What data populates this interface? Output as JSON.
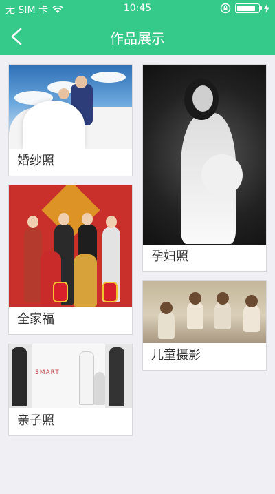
{
  "status_bar": {
    "carrier": "无 SIM 卡",
    "time": "10:45",
    "battery_level": 0.85
  },
  "nav": {
    "title": "作品展示",
    "back_icon": "chevron-left-icon"
  },
  "cards": {
    "wedding": {
      "label": "婚纱照"
    },
    "pregnant": {
      "label": "孕妇照"
    },
    "family": {
      "label": "全家福"
    },
    "kids": {
      "label": "儿童摄影"
    },
    "parent_child": {
      "label": "亲子照",
      "logo_text": "SMART"
    }
  },
  "colors": {
    "header": "#35c98a",
    "background": "#efeff4"
  }
}
